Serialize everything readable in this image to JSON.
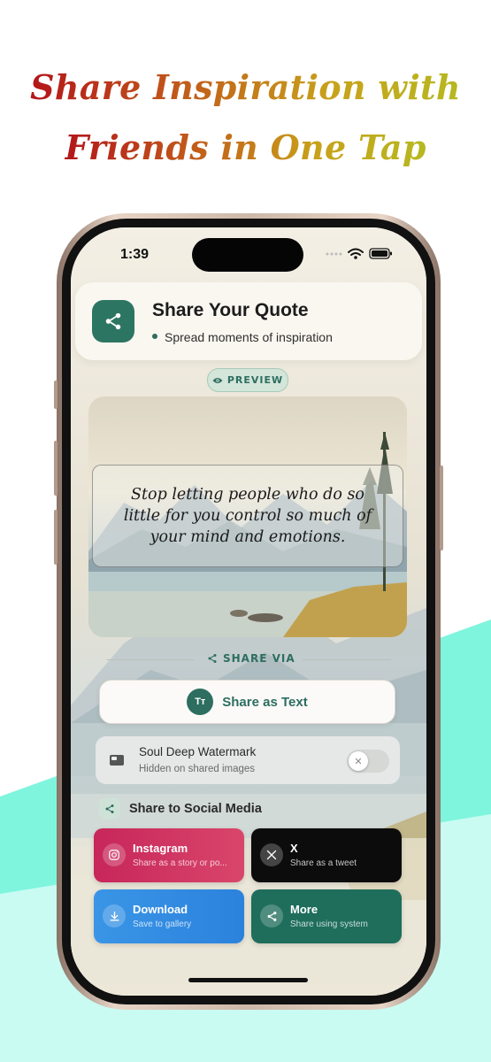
{
  "headline": {
    "line1": "Share Inspiration with",
    "line2": "Friends in One Tap"
  },
  "status_bar": {
    "time": "1:39"
  },
  "header": {
    "title": "Share Your Quote",
    "subtitle": "Spread moments of inspiration"
  },
  "preview_badge": "PREVIEW",
  "quote": "Stop letting people who do so little for you control so much of your mind and emotions.",
  "share_via_label": "SHARE VIA",
  "share_text": {
    "icon_text": "Tт",
    "label": "Share as Text"
  },
  "watermark": {
    "title": "Soul Deep Watermark",
    "subtitle": "Hidden on shared images",
    "toggle_on": false
  },
  "social_header": "Share to Social Media",
  "tiles": [
    {
      "title": "Instagram",
      "subtitle": "Share as a story or po...",
      "icon": "instagram-icon",
      "color": "#c7265a"
    },
    {
      "title": "X",
      "subtitle": "Share as a tweet",
      "icon": "x-logo-icon",
      "color": "#0c0c0c"
    },
    {
      "title": "Download",
      "subtitle": "Save to gallery",
      "icon": "download-icon",
      "color": "#3a95e6"
    },
    {
      "title": "More",
      "subtitle": "Share using system",
      "icon": "share-icon",
      "color": "#1f6e5c"
    }
  ],
  "colors": {
    "accent": "#2d6e60",
    "headline_start": "#b3151a",
    "headline_end": "#b6b820",
    "teal_band": "#7df2dd"
  }
}
